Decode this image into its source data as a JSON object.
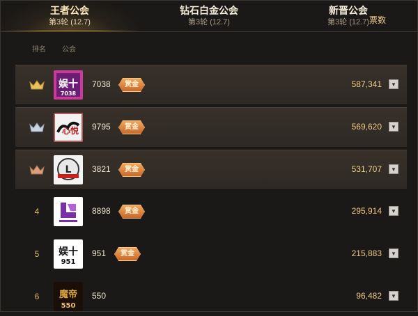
{
  "tabs": [
    {
      "name": "王者公会",
      "sub": "第3轮 (12.7)",
      "active": true
    },
    {
      "name": "钻石白金公会",
      "sub": "第3轮 (12.7)",
      "active": false
    },
    {
      "name": "新晋公会",
      "sub": "第3轮 (12.7)",
      "active": false
    }
  ],
  "columns": {
    "rank": "排名",
    "guild": "公会",
    "score": "票数"
  },
  "rows": [
    {
      "rank": "",
      "rank_icon": "gold-crown-icon",
      "logo_text": "娱十",
      "logo_sub": "7038",
      "id": "7038",
      "badge": "赏金",
      "score": "587,341"
    },
    {
      "rank": "",
      "rank_icon": "silver-crown-icon",
      "logo_text": "心悦",
      "logo_sub": "",
      "id": "9795",
      "badge": "赏金",
      "score": "569,620"
    },
    {
      "rank": "",
      "rank_icon": "bronze-crown-icon",
      "logo_text": "L",
      "logo_sub": "",
      "id": "3821",
      "badge": "赏金",
      "score": "531,707"
    },
    {
      "rank": "4",
      "rank_icon": "",
      "logo_text": "",
      "logo_sub": "",
      "id": "8898",
      "badge": "赏金",
      "score": "295,914"
    },
    {
      "rank": "5",
      "rank_icon": "",
      "logo_text": "娱十",
      "logo_sub": "951",
      "id": "951",
      "badge": "赏金",
      "score": "215,883"
    },
    {
      "rank": "6",
      "rank_icon": "",
      "logo_text": "魔帝",
      "logo_sub": "550",
      "id": "550",
      "badge": "",
      "score": "96,482"
    }
  ],
  "colors": {
    "accent": "#c4984a",
    "score": "#efcc87",
    "badge": "#e0884a"
  }
}
